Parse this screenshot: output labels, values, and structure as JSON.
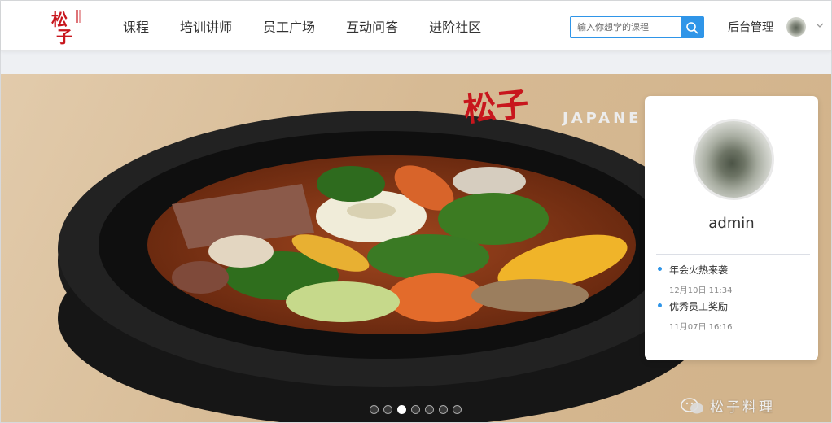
{
  "header": {
    "logo_alt": "松子",
    "nav": [
      "课程",
      "培训讲师",
      "员工广场",
      "互动问答",
      "进阶社区"
    ],
    "search_placeholder": "输入你想学的课程",
    "admin_link": "后台管理"
  },
  "banner": {
    "brand_text": "JAPANE",
    "wechat_text": "松子料理",
    "slide_count": 7,
    "active_slide": 3
  },
  "profile": {
    "username": "admin",
    "news": [
      {
        "title": "年会火热来袭",
        "time": "12月10日 11:34"
      },
      {
        "title": "优秀员工奖励",
        "time": "11月07日 16:16"
      }
    ]
  },
  "colors": {
    "accent": "#2f95e8",
    "logo_red": "#c8161d"
  }
}
